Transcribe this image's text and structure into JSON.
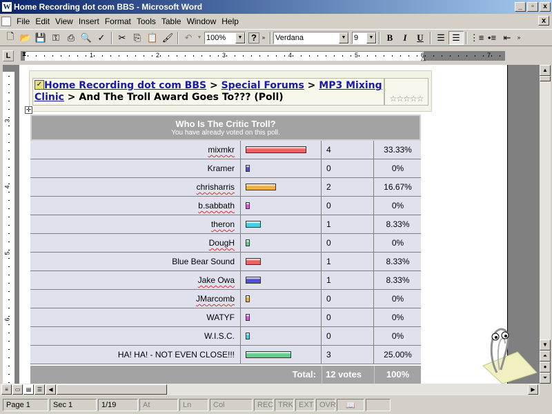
{
  "window": {
    "title": "Home Recording dot com BBS - Microsoft Word",
    "app_icon": "W",
    "min_label": "_",
    "max_label": "▫",
    "close_label": "x"
  },
  "menu": {
    "items": [
      "File",
      "Edit",
      "View",
      "Insert",
      "Format",
      "Tools",
      "Table",
      "Window",
      "Help"
    ],
    "doc_close": "x"
  },
  "toolbar": {
    "zoom": "100%",
    "help_glyph": "?",
    "font": "Verdana",
    "size": "9",
    "bold": "B",
    "italic": "I",
    "underline": "U"
  },
  "ruler": {
    "corner": "L",
    "numbers": [
      "1",
      "2",
      "3",
      "4",
      "5",
      "6",
      "7"
    ]
  },
  "vruler": {
    "numbers": [
      "3",
      "4",
      "5",
      "6"
    ]
  },
  "breadcrumb": {
    "link1": "Home Recording dot com BBS",
    "sep1": " > ",
    "link2": "Special Forums",
    "sep2": " > ",
    "link3": "MP3 Mixing Clinic",
    "rest": " > And The Troll Award Goes To??? (Poll)",
    "rating": "☆☆☆☆☆"
  },
  "poll": {
    "title": "Who Is The Critic Troll?",
    "subtitle": "You have already voted on this poll.",
    "options": [
      {
        "name": "mixmkr",
        "votes": "4",
        "percent": "33.33%",
        "fraction": 0.3333,
        "color": "#f06060",
        "squiggle": true
      },
      {
        "name": "Kramer",
        "votes": "0",
        "percent": "0%",
        "fraction": 0,
        "color": "#5050d0",
        "squiggle": false
      },
      {
        "name": "chrisharris",
        "votes": "2",
        "percent": "16.67%",
        "fraction": 0.1667,
        "color": "#f0b040",
        "squiggle": true
      },
      {
        "name": "b.sabbath",
        "votes": "0",
        "percent": "0%",
        "fraction": 0,
        "color": "#e050e0",
        "squiggle": true
      },
      {
        "name": "theron",
        "votes": "1",
        "percent": "8.33%",
        "fraction": 0.0833,
        "color": "#40d0e0",
        "squiggle": true
      },
      {
        "name": "DougH",
        "votes": "0",
        "percent": "0%",
        "fraction": 0,
        "color": "#60d090",
        "squiggle": true
      },
      {
        "name": "Blue Bear Sound",
        "votes": "1",
        "percent": "8.33%",
        "fraction": 0.0833,
        "color": "#f06060",
        "squiggle": false
      },
      {
        "name": "Jake Owa",
        "votes": "1",
        "percent": "8.33%",
        "fraction": 0.0833,
        "color": "#5050d0",
        "squiggle": true
      },
      {
        "name": "JMarcomb",
        "votes": "0",
        "percent": "0%",
        "fraction": 0,
        "color": "#f0b040",
        "squiggle": true
      },
      {
        "name": "WATYF",
        "votes": "0",
        "percent": "0%",
        "fraction": 0,
        "color": "#e050e0",
        "squiggle": false
      },
      {
        "name": "W.I.S.C.",
        "votes": "0",
        "percent": "0%",
        "fraction": 0,
        "color": "#40d0e0",
        "squiggle": false
      },
      {
        "name": "HA! HA! - NOT EVEN CLOSE!!!",
        "votes": "3",
        "percent": "25.00%",
        "fraction": 0.25,
        "color": "#60d090",
        "squiggle": false
      }
    ],
    "total_label": "Total:",
    "total_votes": "12 votes",
    "total_percent": "100%"
  },
  "status": {
    "page": "Page 1",
    "sec": "Sec 1",
    "pages": "1/19",
    "at": "At",
    "ln": "Ln",
    "col": "Col",
    "rec": "REC",
    "trk": "TRK",
    "ext": "EXT",
    "ovr": "OVR"
  }
}
